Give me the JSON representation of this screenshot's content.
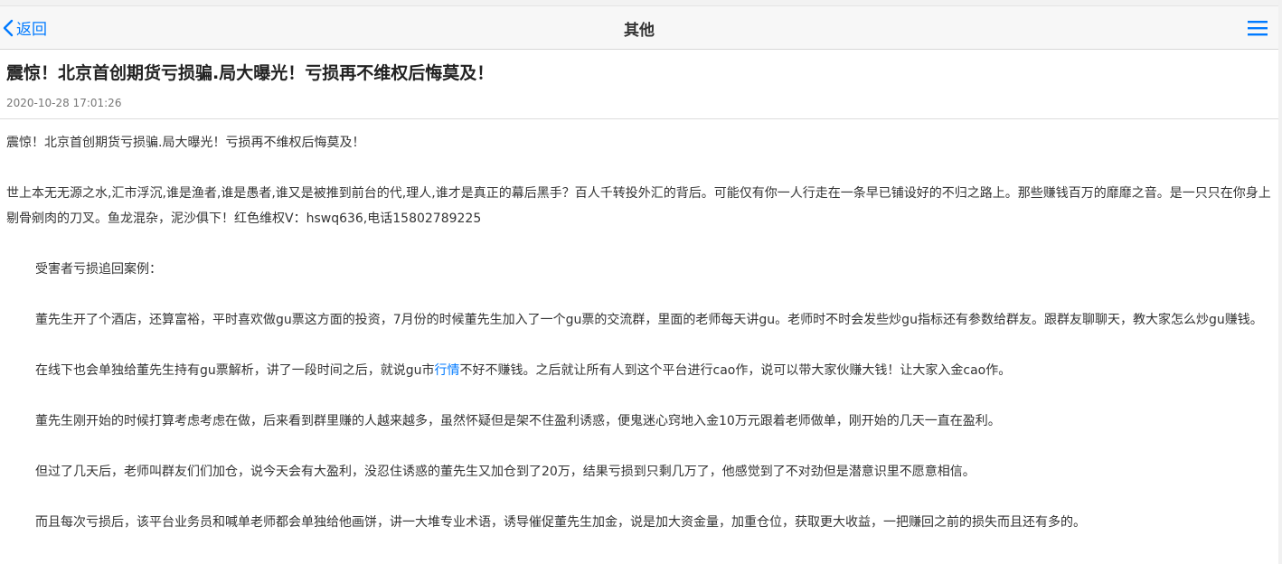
{
  "nav": {
    "back_label": "返回",
    "title": "其他"
  },
  "article": {
    "title": "震惊！北京首创期货亏损骗.局大曝光！亏损再不维权后悔莫及！",
    "date": "2020-10-28 17:01:26",
    "p1": "震惊！北京首创期货亏损骗.局大曝光！亏损再不维权后悔莫及！",
    "p2": "世上本无无源之水,汇市浮沉,谁是渔者,谁是愚者,谁又是被推到前台的代,理人,谁才是真正的幕后黑手？百人千转投外汇的背后。可能仅有你一人行走在一条早已铺设好的不归之路上。那些赚钱百万的靡靡之音。是一只只在你身上剔骨剜肉的刀叉。鱼龙混杂，泥沙俱下！红色维权V：hswq636,电话15802789225",
    "p3": "受害者亏损追回案例：",
    "p4": "董先生开了个酒店，还算富裕，平时喜欢做gu票这方面的投资，7月份的时候董先生加入了一个gu票的交流群，里面的老师每天讲gu。老师时不时会发些炒gu指标还有参数给群友。跟群友聊聊天，教大家怎么炒gu赚钱。",
    "p5_before": "在线下也会单独给董先生持有gu票解析，讲了一段时间之后，就说gu市",
    "p5_link": "行情",
    "p5_after": "不好不赚钱。之后就让所有人到这个平台进行cao作，说可以带大家伙赚大钱！让大家入金cao作。",
    "p6": "董先生刚开始的时候打算考虑考虑在做，后来看到群里赚的人越来越多，虽然怀疑但是架不住盈利诱惑，便鬼迷心窍地入金10万元跟着老师做单，刚开始的几天一直在盈利。",
    "p7": "但过了几天后，老师叫群友们们加仓，说今天会有大盈利，没忍住诱惑的董先生又加仓到了20万，结果亏损到只剩几万了，他感觉到了不对劲但是潜意识里不愿意相信。",
    "p8": "而且每次亏损后，该平台业务员和喊单老师都会单独给他画饼，讲一大堆专业术语，诱导催促董先生加金，说是加大资金量，加重仓位，获取更大收益，一把赚回之前的损失而且还有多的。"
  },
  "icons": {
    "back": "chevron-left-icon",
    "menu": "hamburger-menu-icon"
  },
  "colors": {
    "accent": "#007aff",
    "navbar_bg": "#f7f7f7",
    "text": "#333333"
  }
}
